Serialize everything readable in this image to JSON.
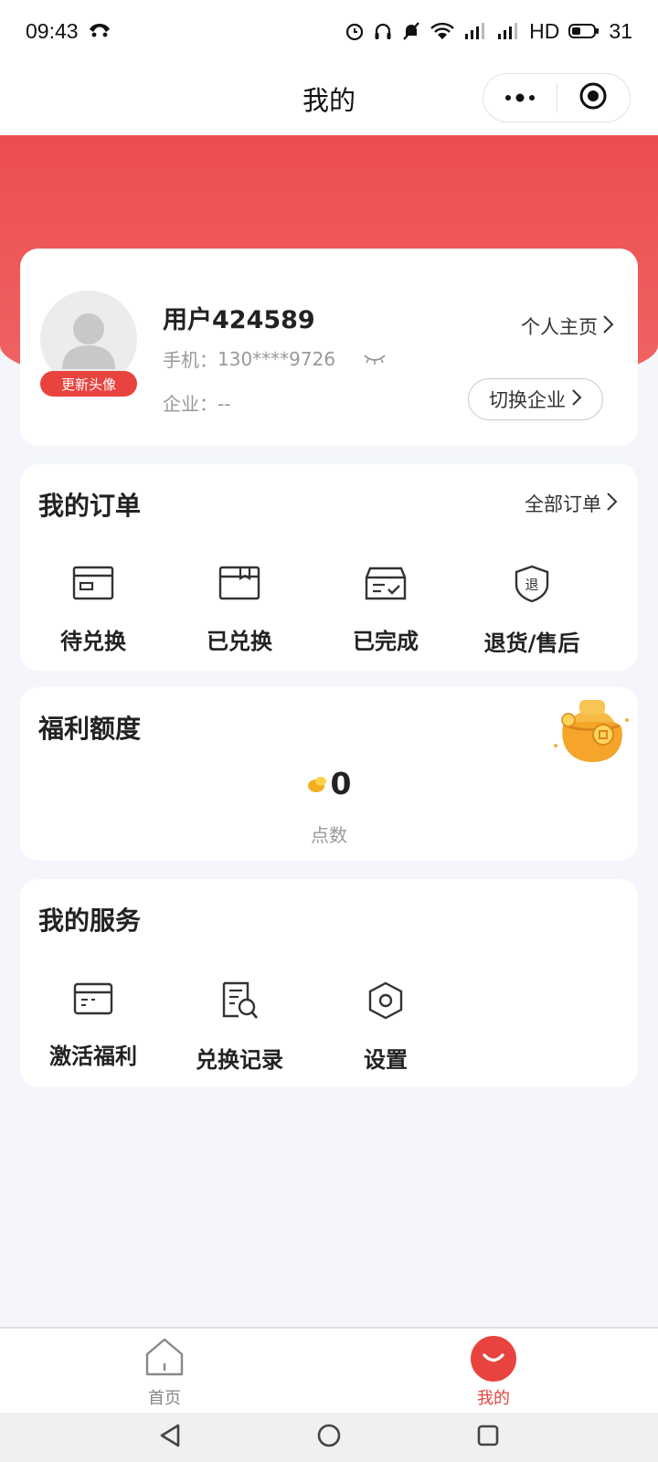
{
  "status_bar": {
    "time": "09:43",
    "battery": "31",
    "network": "HD"
  },
  "nav": {
    "title": "我的"
  },
  "profile": {
    "name": "用户424589",
    "phone_label": "手机：",
    "phone": "130****9726",
    "company_label": "企业：",
    "company": "--",
    "avatar_badge": "更新头像",
    "homepage_link": "个人主页",
    "switch_company": "切换企业"
  },
  "orders": {
    "title": "我的订单",
    "all_link": "全部订单",
    "items": [
      {
        "label": "待兑换",
        "icon": "pending-exchange-icon"
      },
      {
        "label": "已兑换",
        "icon": "exchanged-box-icon"
      },
      {
        "label": "已完成",
        "icon": "completed-box-icon"
      },
      {
        "label": "退货/售后",
        "icon": "refund-shield-icon"
      }
    ],
    "refund_icon_char": "退"
  },
  "benefit": {
    "title": "福利额度",
    "points_value": "0",
    "points_label": "点数"
  },
  "services": {
    "title": "我的服务",
    "items": [
      {
        "label": "激活福利",
        "icon": "activate-card-icon"
      },
      {
        "label": "兑换记录",
        "icon": "records-search-icon"
      },
      {
        "label": "设置",
        "icon": "settings-hexagon-icon"
      }
    ]
  },
  "tabs": [
    {
      "label": "首页",
      "icon": "home-icon",
      "active": false
    },
    {
      "label": "我的",
      "icon": "smile-icon",
      "active": true
    }
  ],
  "colors": {
    "brand": "#e8433f",
    "background": "#f4f6fb"
  }
}
